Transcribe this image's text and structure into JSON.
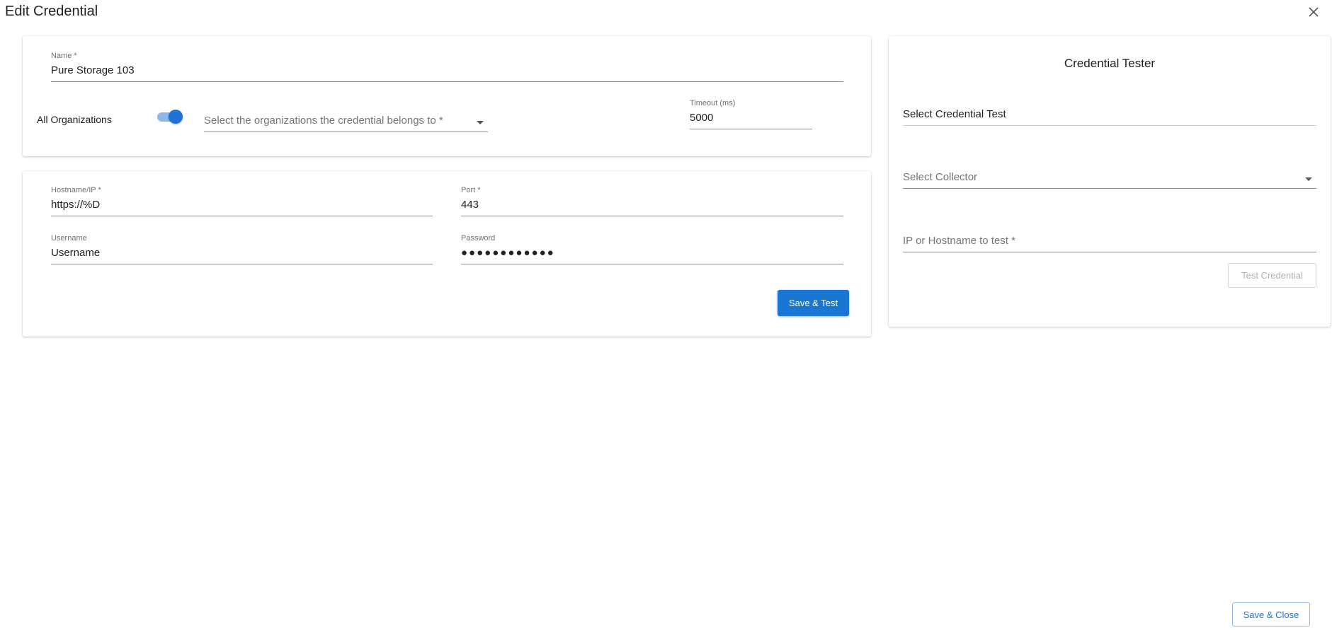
{
  "dialog": {
    "title": "Edit Credential",
    "close_icon": "close-icon",
    "save_close_label": "Save & Close"
  },
  "general": {
    "name_label": "Name *",
    "name_value": "Pure Storage 103",
    "all_orgs_label": "All Organizations",
    "all_orgs_enabled": true,
    "orgs_placeholder": "Select the organizations the credential belongs to *",
    "timeout_label": "Timeout (ms)",
    "timeout_value": "5000"
  },
  "connection": {
    "hostname_label": "Hostname/IP *",
    "hostname_value": "https://%D",
    "port_label": "Port *",
    "port_value": "443",
    "username_label": "Username",
    "username_value": "Username",
    "password_label": "Password",
    "password_value": "●●●●●●●●●●●●",
    "save_test_label": "Save & Test"
  },
  "tester": {
    "title": "Credential Tester",
    "test_select_value": "Select Credential Test",
    "collector_placeholder": "Select Collector",
    "target_placeholder": "IP or Hostname to test *",
    "test_button_label": "Test Credential"
  },
  "colors": {
    "accent": "#1976d2",
    "toggle_track": "#8fb6e8"
  }
}
